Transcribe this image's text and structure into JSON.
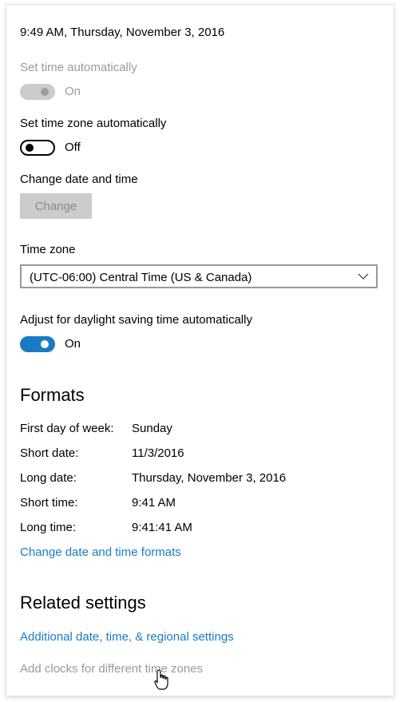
{
  "datetime_header": "9:49 AM, Thursday, November 3, 2016",
  "set_time_auto": {
    "label": "Set time automatically",
    "state": "On"
  },
  "set_timezone_auto": {
    "label": "Set time zone automatically",
    "state": "Off"
  },
  "change_datetime": {
    "label": "Change date and time",
    "button": "Change"
  },
  "time_zone": {
    "label": "Time zone",
    "selected": "(UTC-06:00) Central Time (US & Canada)"
  },
  "dst": {
    "label": "Adjust for daylight saving time automatically",
    "state": "On"
  },
  "formats": {
    "title": "Formats",
    "rows": [
      {
        "label": "First day of week:",
        "value": "Sunday"
      },
      {
        "label": "Short date:",
        "value": "11/3/2016"
      },
      {
        "label": "Long date:",
        "value": "Thursday, November 3, 2016"
      },
      {
        "label": "Short time:",
        "value": "9:41 AM"
      },
      {
        "label": "Long time:",
        "value": "9:41:41 AM"
      }
    ],
    "change_link": "Change date and time formats"
  },
  "related": {
    "title": "Related settings",
    "link1": "Additional date, time, & regional settings",
    "link2": "Add clocks for different time zones"
  },
  "colors": {
    "accent": "#1a7bc4",
    "disabled": "#cccccc"
  }
}
